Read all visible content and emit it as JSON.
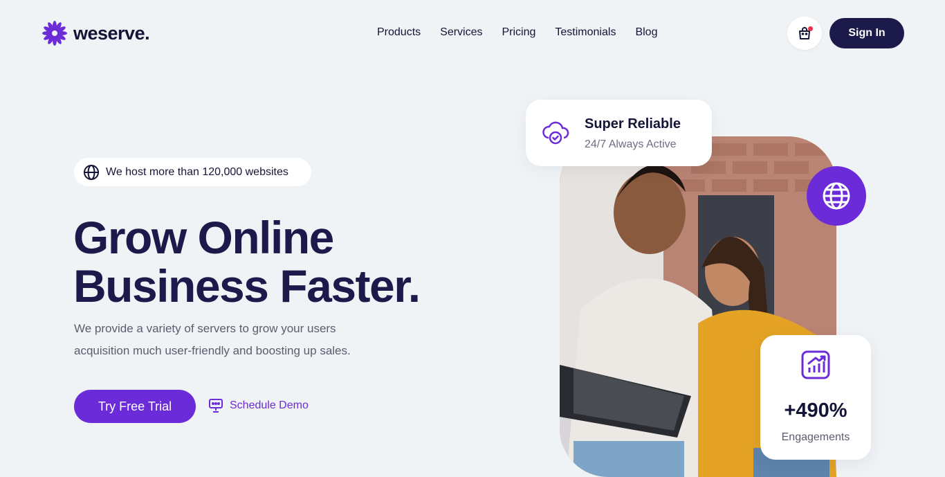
{
  "brand": {
    "name": "weserve.",
    "accent": "#6c2bd9",
    "dark": "#1b1a4b"
  },
  "nav": {
    "items": [
      {
        "label": "Products"
      },
      {
        "label": "Services"
      },
      {
        "label": "Pricing"
      },
      {
        "label": "Testimonials"
      },
      {
        "label": "Blog"
      }
    ],
    "cart_icon": "shopping-bag-icon",
    "signin_label": "Sign In"
  },
  "hero": {
    "badge": "We host more than 120,000 websites",
    "headline_line1": "Grow Online",
    "headline_line2": "Business Faster.",
    "subtext": "We provide a variety of servers to grow your users acquisition much user-friendly and boosting up sales.",
    "primary_cta": "Try Free Trial",
    "secondary_cta": "Schedule Demo"
  },
  "cards": {
    "reliable_title": "Super Reliable",
    "reliable_sub": "24/7 Always Active",
    "stat_value": "+490%",
    "stat_label": "Engagements"
  }
}
